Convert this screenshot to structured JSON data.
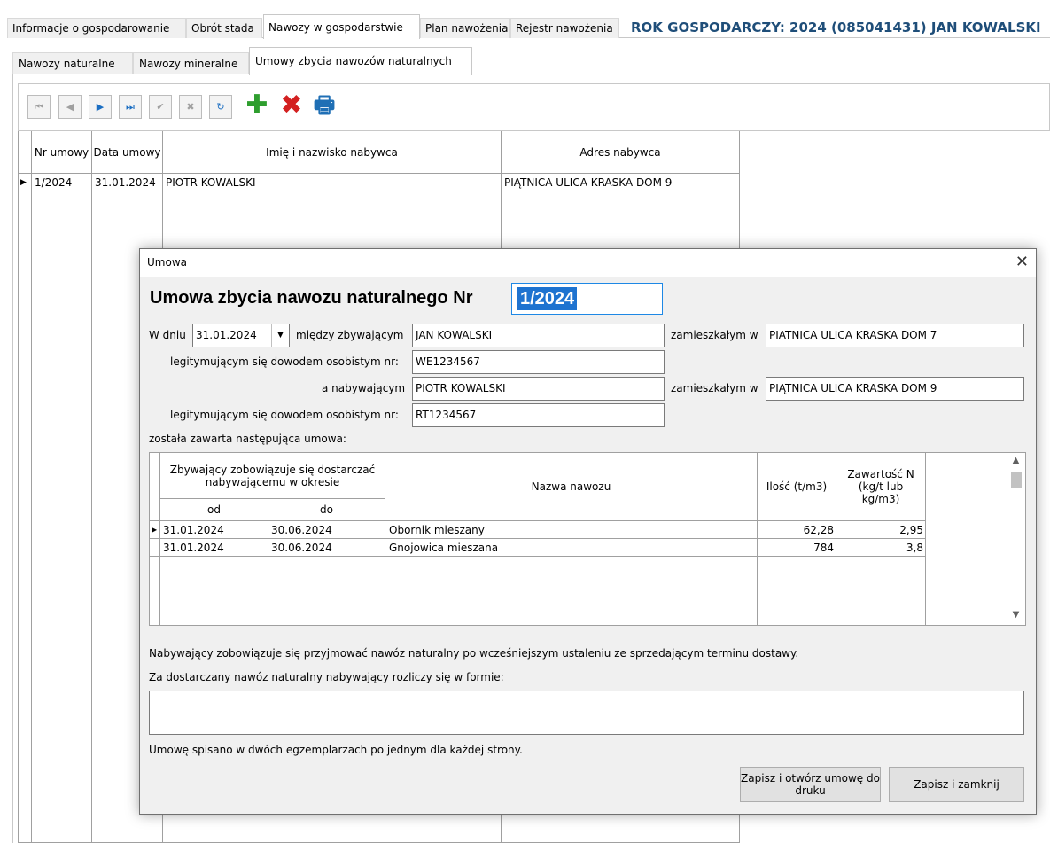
{
  "header": {
    "tabs": [
      {
        "label": "Informacje o gospodarowanie"
      },
      {
        "label": "Obrót stada"
      },
      {
        "label": "Nawozy w gospodarstwie"
      },
      {
        "label": "Plan nawożenia"
      },
      {
        "label": "Rejestr nawożenia"
      }
    ],
    "title": "ROK GOSPODARCZY: 2024  (085041431) JAN KOWALSKI"
  },
  "subtabs": [
    {
      "label": "Nawozy naturalne"
    },
    {
      "label": "Nawozy mineralne"
    },
    {
      "label": "Umowy zbycia nawozów naturalnych"
    }
  ],
  "toolbar": {
    "first": "⏮",
    "prev": "◀",
    "next": "▶",
    "last": "⏭",
    "accept": "✔",
    "cancel": "✖",
    "refresh": "↻",
    "add_icon": "✚",
    "delete_icon": "✖",
    "print_icon": "🖶"
  },
  "grid": {
    "headers": [
      "Nr umowy",
      "Data umowy",
      "Imię i nazwisko nabywca",
      "Adres nabywca"
    ],
    "rows": [
      {
        "nr": "1/2024",
        "data": "31.01.2024",
        "name": "PIOTR KOWALSKI",
        "address": "PIĄTNICA ULICA KRASKA DOM 9"
      }
    ]
  },
  "dialog": {
    "title": "Umowa",
    "close": "✕",
    "heading": "Umowa zbycia nawozu naturalnego Nr",
    "contract_no": "1/2024",
    "w_dniu_label": "W dniu",
    "date": "31.01.2024",
    "miedzy_label": "między zbywającym",
    "seller_name": "JAN KOWALSKI",
    "zamieszkalym_label": "zamieszkałym w",
    "seller_address": "PIATNICA ULICA KRASKA DOM 7",
    "id_label": "legitymującym się dowodem osobistym nr:",
    "seller_id": "WE1234567",
    "nabywajacym_label": "a nabywającym",
    "buyer_name": "PIOTR KOWALSKI",
    "buyer_address": "PIĄTNICA ULICA KRASKA DOM 9",
    "buyer_id": "RT1234567",
    "zawarta_label": "została zawarta następująca umowa:",
    "inner_grid": {
      "period_header": "Zbywający zobowiązuje się dostarczać nabywającemu w okresie",
      "od_header": "od",
      "do_header": "do",
      "name_header": "Nazwa nawozu",
      "qty_header": "Ilość (t/m3)",
      "n_header": "Zawartość N (kg/t lub kg/m3)",
      "rows": [
        {
          "od": "31.01.2024",
          "do": "30.06.2024",
          "name": "Obornik mieszany",
          "qty": "62,28",
          "n": "2,95"
        },
        {
          "od": "31.01.2024",
          "do": "30.06.2024",
          "name": "Gnojowica mieszana",
          "qty": "784",
          "n": "3,8"
        }
      ]
    },
    "obligation_text": "Nabywający zobowiązuje się przyjmować nawóz naturalny po wcześniejszym ustaleniu ze sprzedającym terminu dostawy.",
    "payment_label": "Za dostarczany nawóz naturalny nabywający rozliczy się w formie:",
    "payment_value": "",
    "copies_text": "Umowę spisano w dwóch egzemplarzach po jednym dla każdej strony.",
    "save_print_button": "Zapisz i otwórz umowę do druku",
    "save_close_button": "Zapisz i zamknij"
  }
}
